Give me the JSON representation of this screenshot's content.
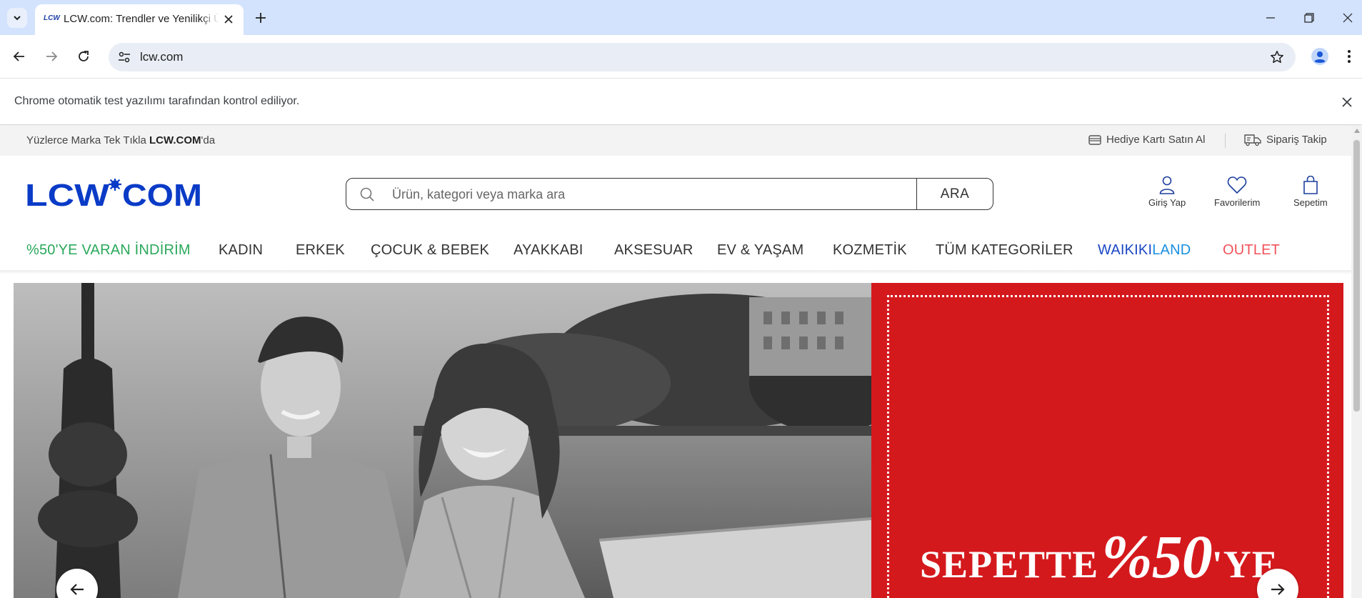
{
  "browser": {
    "tab_title": "LCW.com: Trendler ve Yenilikçi Ürünler",
    "tab_favicon_text": "LCW",
    "url": "lcw.com",
    "automation_notice": "Chrome otomatik test yazılımı tarafından kontrol ediliyor.",
    "icons": [
      "tab-search-icon",
      "close-icon",
      "plus-icon",
      "minimize-icon",
      "restore-icon",
      "back-arrow-icon",
      "forward-arrow-icon",
      "reload-icon",
      "site-settings-icon",
      "star-icon",
      "profile-icon",
      "kebab-menu-icon"
    ]
  },
  "topbar": {
    "promo_prefix": "Yüzlerce Marka Tek Tıkla ",
    "promo_brand": "LCW.COM",
    "promo_suffix": "'da",
    "gift_card": "Hediye Kartı Satın Al",
    "order_tracking": "Sipariş Takip"
  },
  "header": {
    "logo_text": "LCW COM",
    "search_placeholder": "Ürün, kategori veya marka ara",
    "search_button": "ARA",
    "login": "Giriş Yap",
    "favorites": "Favorilerim",
    "cart": "Sepetim"
  },
  "menu": {
    "items": [
      {
        "label": "%50'YE VARAN İNDİRİM",
        "color": "#2aa85b"
      },
      {
        "label": "KADIN"
      },
      {
        "label": "ERKEK"
      },
      {
        "label": "ÇOCUK & BEBEK"
      },
      {
        "label": "AYAKKABI"
      },
      {
        "label": "AKSESUAR"
      },
      {
        "label": "EV & YAŞAM"
      },
      {
        "label": "KOZMETİK"
      },
      {
        "label": "TÜM KATEGORİLER"
      }
    ],
    "waikiki_part1": "WAIKIKI",
    "waikiki_part2": "LAND",
    "outlet": "OUTLET"
  },
  "hero": {
    "promo_word1": "SEPETTE",
    "promo_word2": "%50",
    "promo_word3": "'YE",
    "promo_bg": "#d4191d"
  },
  "colors": {
    "brand_blue": "#0a3bc7",
    "discount_green": "#2aa85b",
    "waikiki_blue": "#1b47c4",
    "land_blue": "#1a8fe0",
    "outlet_red": "#f0525a"
  }
}
